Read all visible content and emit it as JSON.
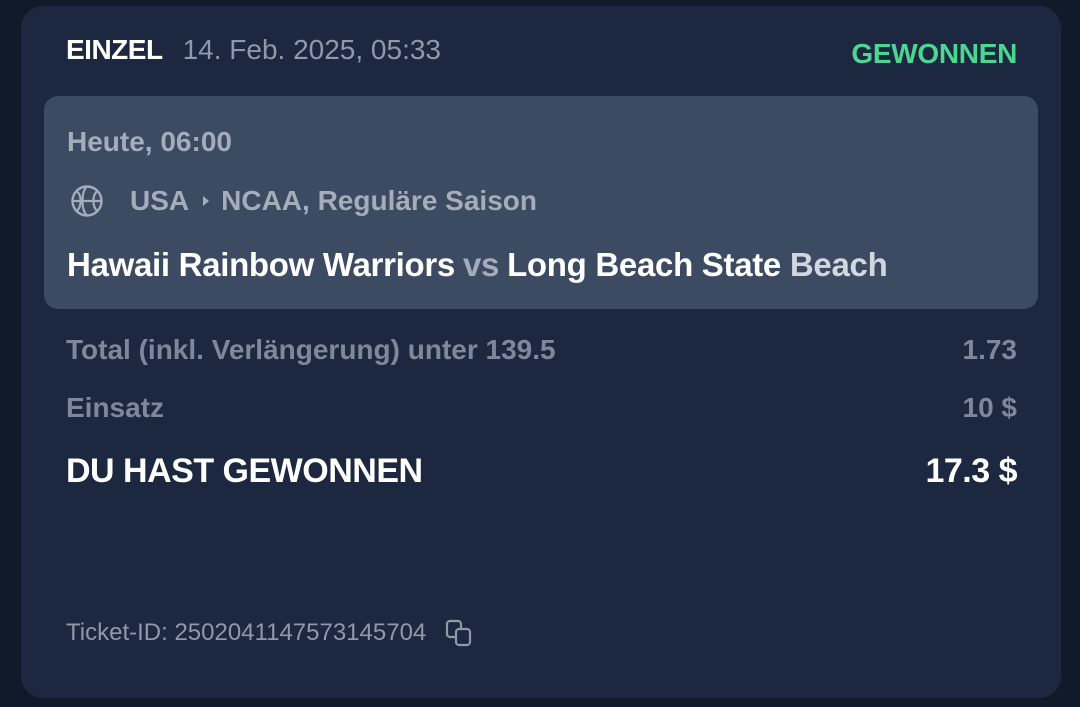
{
  "header": {
    "bet_type": "EINZEL",
    "date": "14. Feb. 2025, 05:33",
    "status": "GEWONNEN",
    "status_color": "#4cd790"
  },
  "event": {
    "time": "Heute, 06:00",
    "sport_icon": "basketball-icon",
    "country": "USA",
    "league": "NCAA, Reguläre Saison",
    "home_team": "Hawaii Rainbow Warriors",
    "vs": "vs",
    "away_team_main": "Long Beach State",
    "away_team_fade": "Beach"
  },
  "bet": {
    "market": "Total (inkl. Verlängerung) unter 139.5",
    "odds": "1.73",
    "stake_label": "Einsatz",
    "stake_value": "10 $",
    "payout_label": "DU HAST GEWONNEN",
    "payout_value": "17.3 $"
  },
  "ticket": {
    "label": "Ticket-ID: 2502041147573145704",
    "copy_icon": "copy-icon"
  }
}
